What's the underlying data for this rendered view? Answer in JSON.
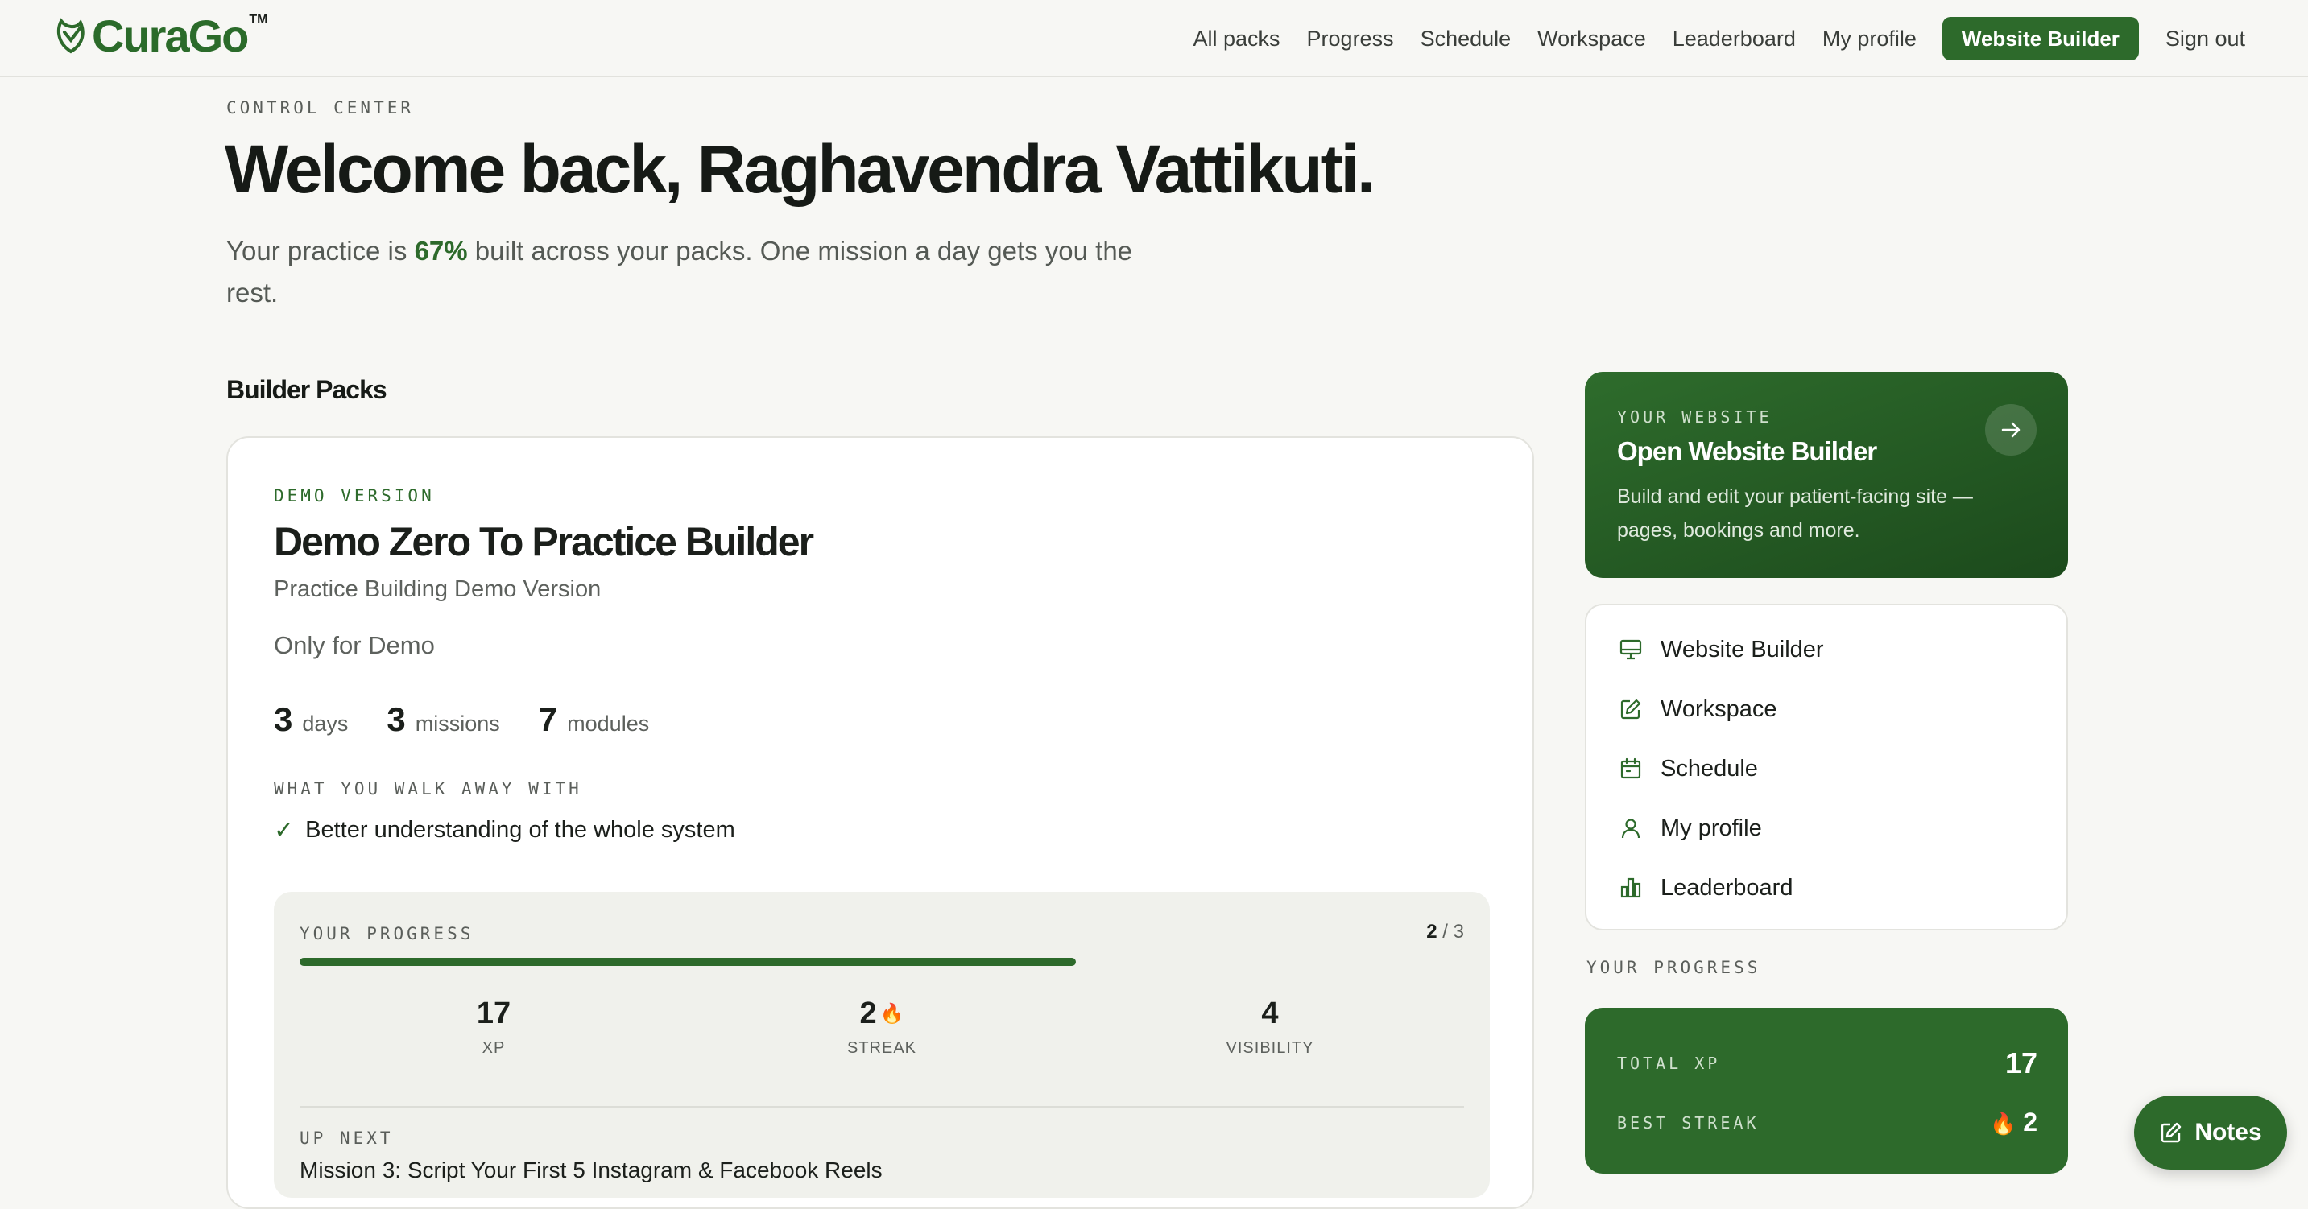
{
  "brand": {
    "name": "CuraGo",
    "tm": "TM",
    "color": "#2d6a2b"
  },
  "nav": {
    "items": [
      "All packs",
      "Progress",
      "Schedule",
      "Workspace",
      "Leaderboard",
      "My profile"
    ],
    "cta": "Website Builder",
    "signout": "Sign out"
  },
  "hero": {
    "eyebrow": "CONTROL CENTER",
    "title": "Welcome back, Raghavendra Vattikuti.",
    "lead_prefix": "Your practice is ",
    "lead_percent": "67%",
    "lead_suffix": " built across your packs. One mission a day gets you the rest."
  },
  "packs": {
    "section_title": "Builder Packs",
    "card": {
      "tag": "DEMO VERSION",
      "title": "Demo Zero To Practice Builder",
      "subtitle": "Practice Building Demo Version",
      "description": "Only for Demo",
      "stats": [
        {
          "num": "3",
          "label": "days"
        },
        {
          "num": "3",
          "label": "missions"
        },
        {
          "num": "7",
          "label": "modules"
        }
      ],
      "walk_label": "WHAT YOU WALK AWAY WITH",
      "benefits": [
        "Better understanding of the whole system"
      ],
      "progress": {
        "label": "YOUR PROGRESS",
        "done": "2",
        "total": "3",
        "fraction": 0.667,
        "stats": [
          {
            "value": "17",
            "label": "XP",
            "flame": false
          },
          {
            "value": "2",
            "label": "STREAK",
            "flame": true
          },
          {
            "value": "4",
            "label": "VISIBILITY",
            "flame": false
          }
        ],
        "up_next_label": "UP NEXT",
        "up_next": "Mission 3: Script Your First 5 Instagram & Facebook Reels"
      }
    }
  },
  "sidebar": {
    "website_card": {
      "eyebrow": "YOUR WEBSITE",
      "title": "Open Website Builder",
      "description": "Build and edit your patient-facing site — pages, bookings and more."
    },
    "links": [
      {
        "label": "Website Builder",
        "icon": "monitor-icon"
      },
      {
        "label": "Workspace",
        "icon": "edit-icon"
      },
      {
        "label": "Schedule",
        "icon": "calendar-icon"
      },
      {
        "label": "My profile",
        "icon": "user-icon"
      },
      {
        "label": "Leaderboard",
        "icon": "bar-chart-icon"
      }
    ],
    "progress_label": "YOUR PROGRESS",
    "total_xp_label": "TOTAL XP",
    "total_xp": "17",
    "best_streak_label": "BEST STREAK",
    "best_streak": "2"
  },
  "notes_button": "Notes"
}
